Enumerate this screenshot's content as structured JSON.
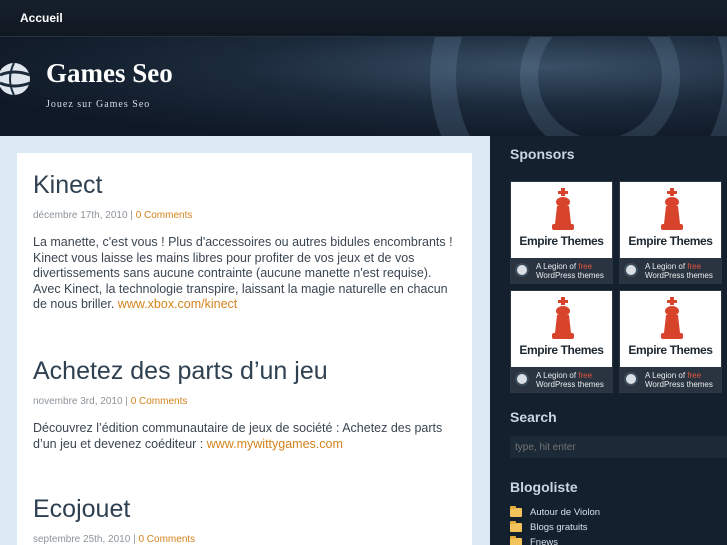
{
  "nav": {
    "home_label": "Accueil"
  },
  "header": {
    "title": "Games Seo",
    "tagline": "Jouez sur Games Seo"
  },
  "posts": [
    {
      "title": "Kinect",
      "date": "décembre 17th, 2010",
      "separator": "|",
      "comments": "0 Comments",
      "body": "La manette, c'est vous ! Plus d'accessoires ou autres bidules encombrants ! Kinect vous laisse les mains libres pour profiter de vos jeux et de vos divertissements sans aucune contrainte (aucune manette n'est requise). Avec Kinect, la technologie transpire, laissant la magie naturelle en chacun de nous briller.",
      "link": "www.xbox.com/kinect"
    },
    {
      "title": "Achetez des parts d’un jeu",
      "date": "novembre 3rd, 2010",
      "separator": "|",
      "comments": "0 Comments",
      "body": "Découvrez l’édition communautaire de jeux de société : Achetez des parts d’un jeu et devenez coéditeur :",
      "link": "www.mywittygames.com"
    },
    {
      "title": "Ecojouet",
      "date": "septembre 25th, 2010",
      "separator": "|",
      "comments": "0 Comments"
    }
  ],
  "sidebar": {
    "sponsors_title": "Sponsors",
    "ad": {
      "name": "Empire Themes",
      "line1_prefix": "A Legion of",
      "line1_highlight": "free",
      "line2": "WordPress themes"
    },
    "search_title": "Search",
    "search_placeholder": "type, hit enter",
    "blogroll_title": "Blogoliste",
    "blogroll": [
      "Autour de Violon",
      "Blogs gratuits",
      "Fnews"
    ]
  },
  "colors": {
    "accent_link": "#d4831c",
    "sidebar_heading": "#c7d6e4",
    "content_bg": "#ffffff",
    "page_bg": "#0f1a29"
  }
}
